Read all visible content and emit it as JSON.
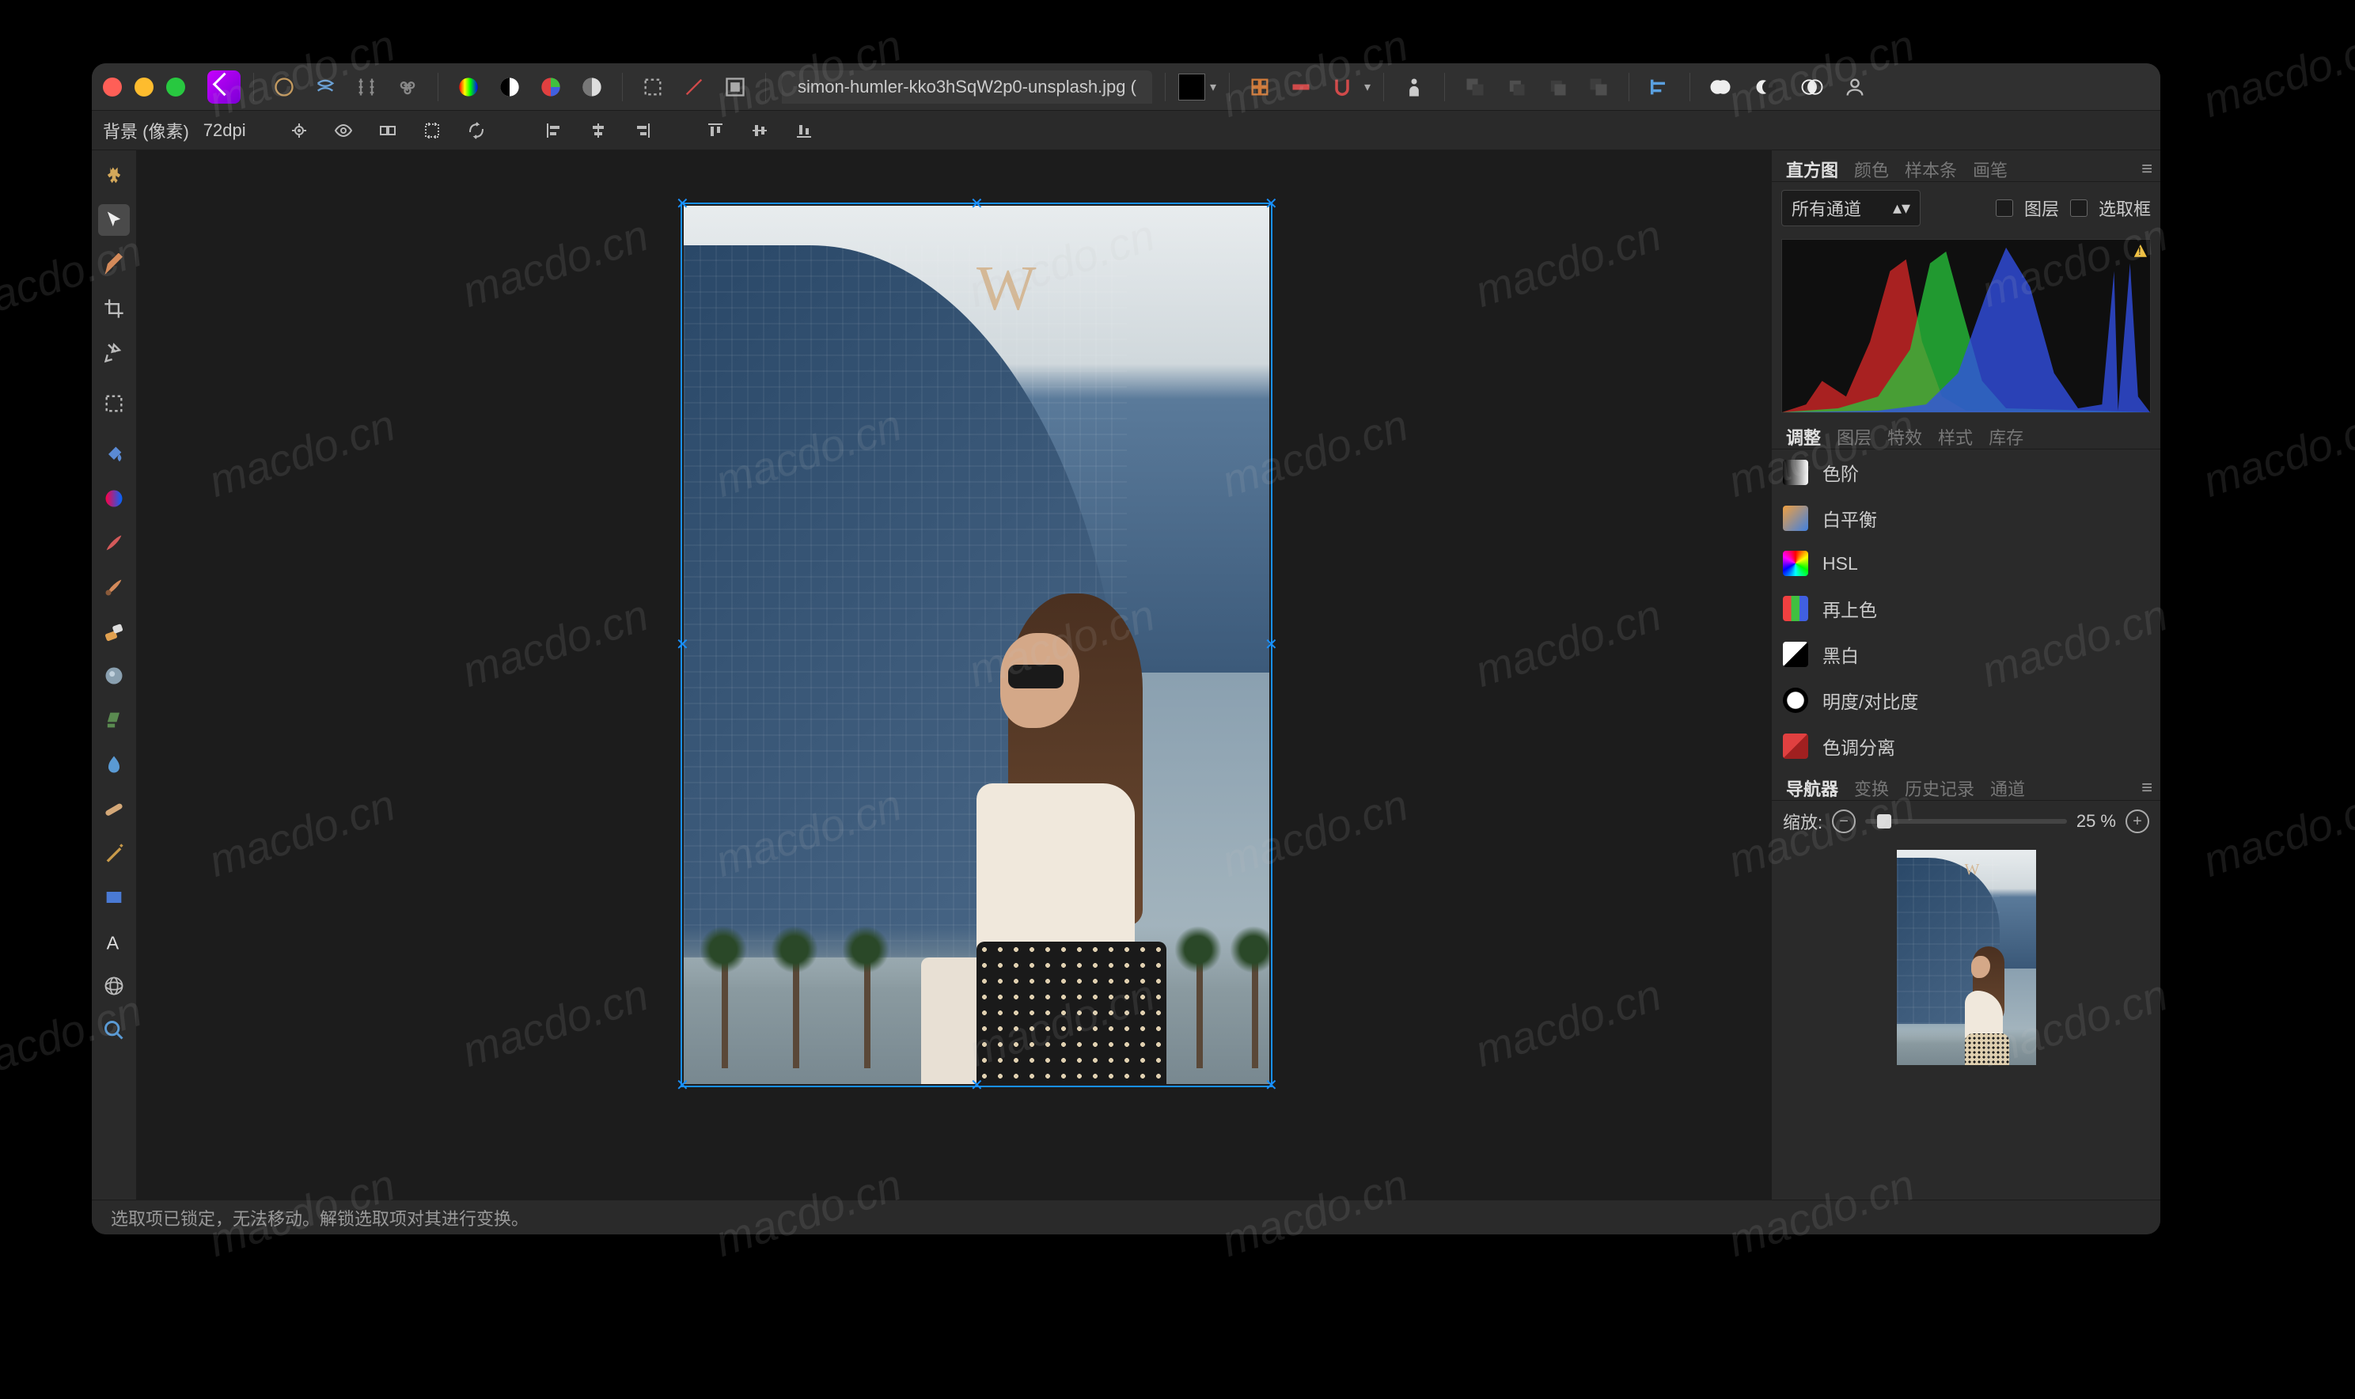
{
  "watermark": "macdo.cn",
  "titlebar": {
    "document_name": "simon-humler-kko3hSqW2p0-unsplash.jpg ("
  },
  "context_bar": {
    "layer_label": "背景 (像素)",
    "dpi": "72dpi"
  },
  "status_bar": {
    "message": "选取项已锁定，无法移动。解锁选取项对其进行变换。"
  },
  "panels": {
    "histogram": {
      "tabs": [
        "直方图",
        "颜色",
        "样本条",
        "画笔"
      ],
      "active_tab": "直方图",
      "channel_select": "所有通道",
      "check_layer": "图层",
      "check_marquee": "选取框"
    },
    "adjust": {
      "tabs": [
        "调整",
        "图层",
        "特效",
        "样式",
        "库存"
      ],
      "active_tab": "调整",
      "items": [
        {
          "label": "色阶",
          "key": "levels"
        },
        {
          "label": "白平衡",
          "key": "white-balance"
        },
        {
          "label": "HSL",
          "key": "hsl"
        },
        {
          "label": "再上色",
          "key": "recolour"
        },
        {
          "label": "黑白",
          "key": "bw"
        },
        {
          "label": "明度/对比度",
          "key": "brightness-contrast"
        },
        {
          "label": "色调分离",
          "key": "posterise"
        }
      ]
    },
    "navigator": {
      "tabs": [
        "导航器",
        "变换",
        "历史记录",
        "通道"
      ],
      "active_tab": "导航器",
      "zoom_label": "缩放:",
      "zoom_value": "25 %"
    }
  },
  "tools": [
    "hand",
    "move",
    "paint-select",
    "crop",
    "flood-select",
    "marquee",
    "flood-fill",
    "gradient",
    "paint-brush",
    "pixel-brush",
    "erase",
    "smudge",
    "clone",
    "blur",
    "heal",
    "pen",
    "rectangle",
    "text",
    "mesh",
    "zoom"
  ],
  "image": {
    "w_logo": "W"
  }
}
